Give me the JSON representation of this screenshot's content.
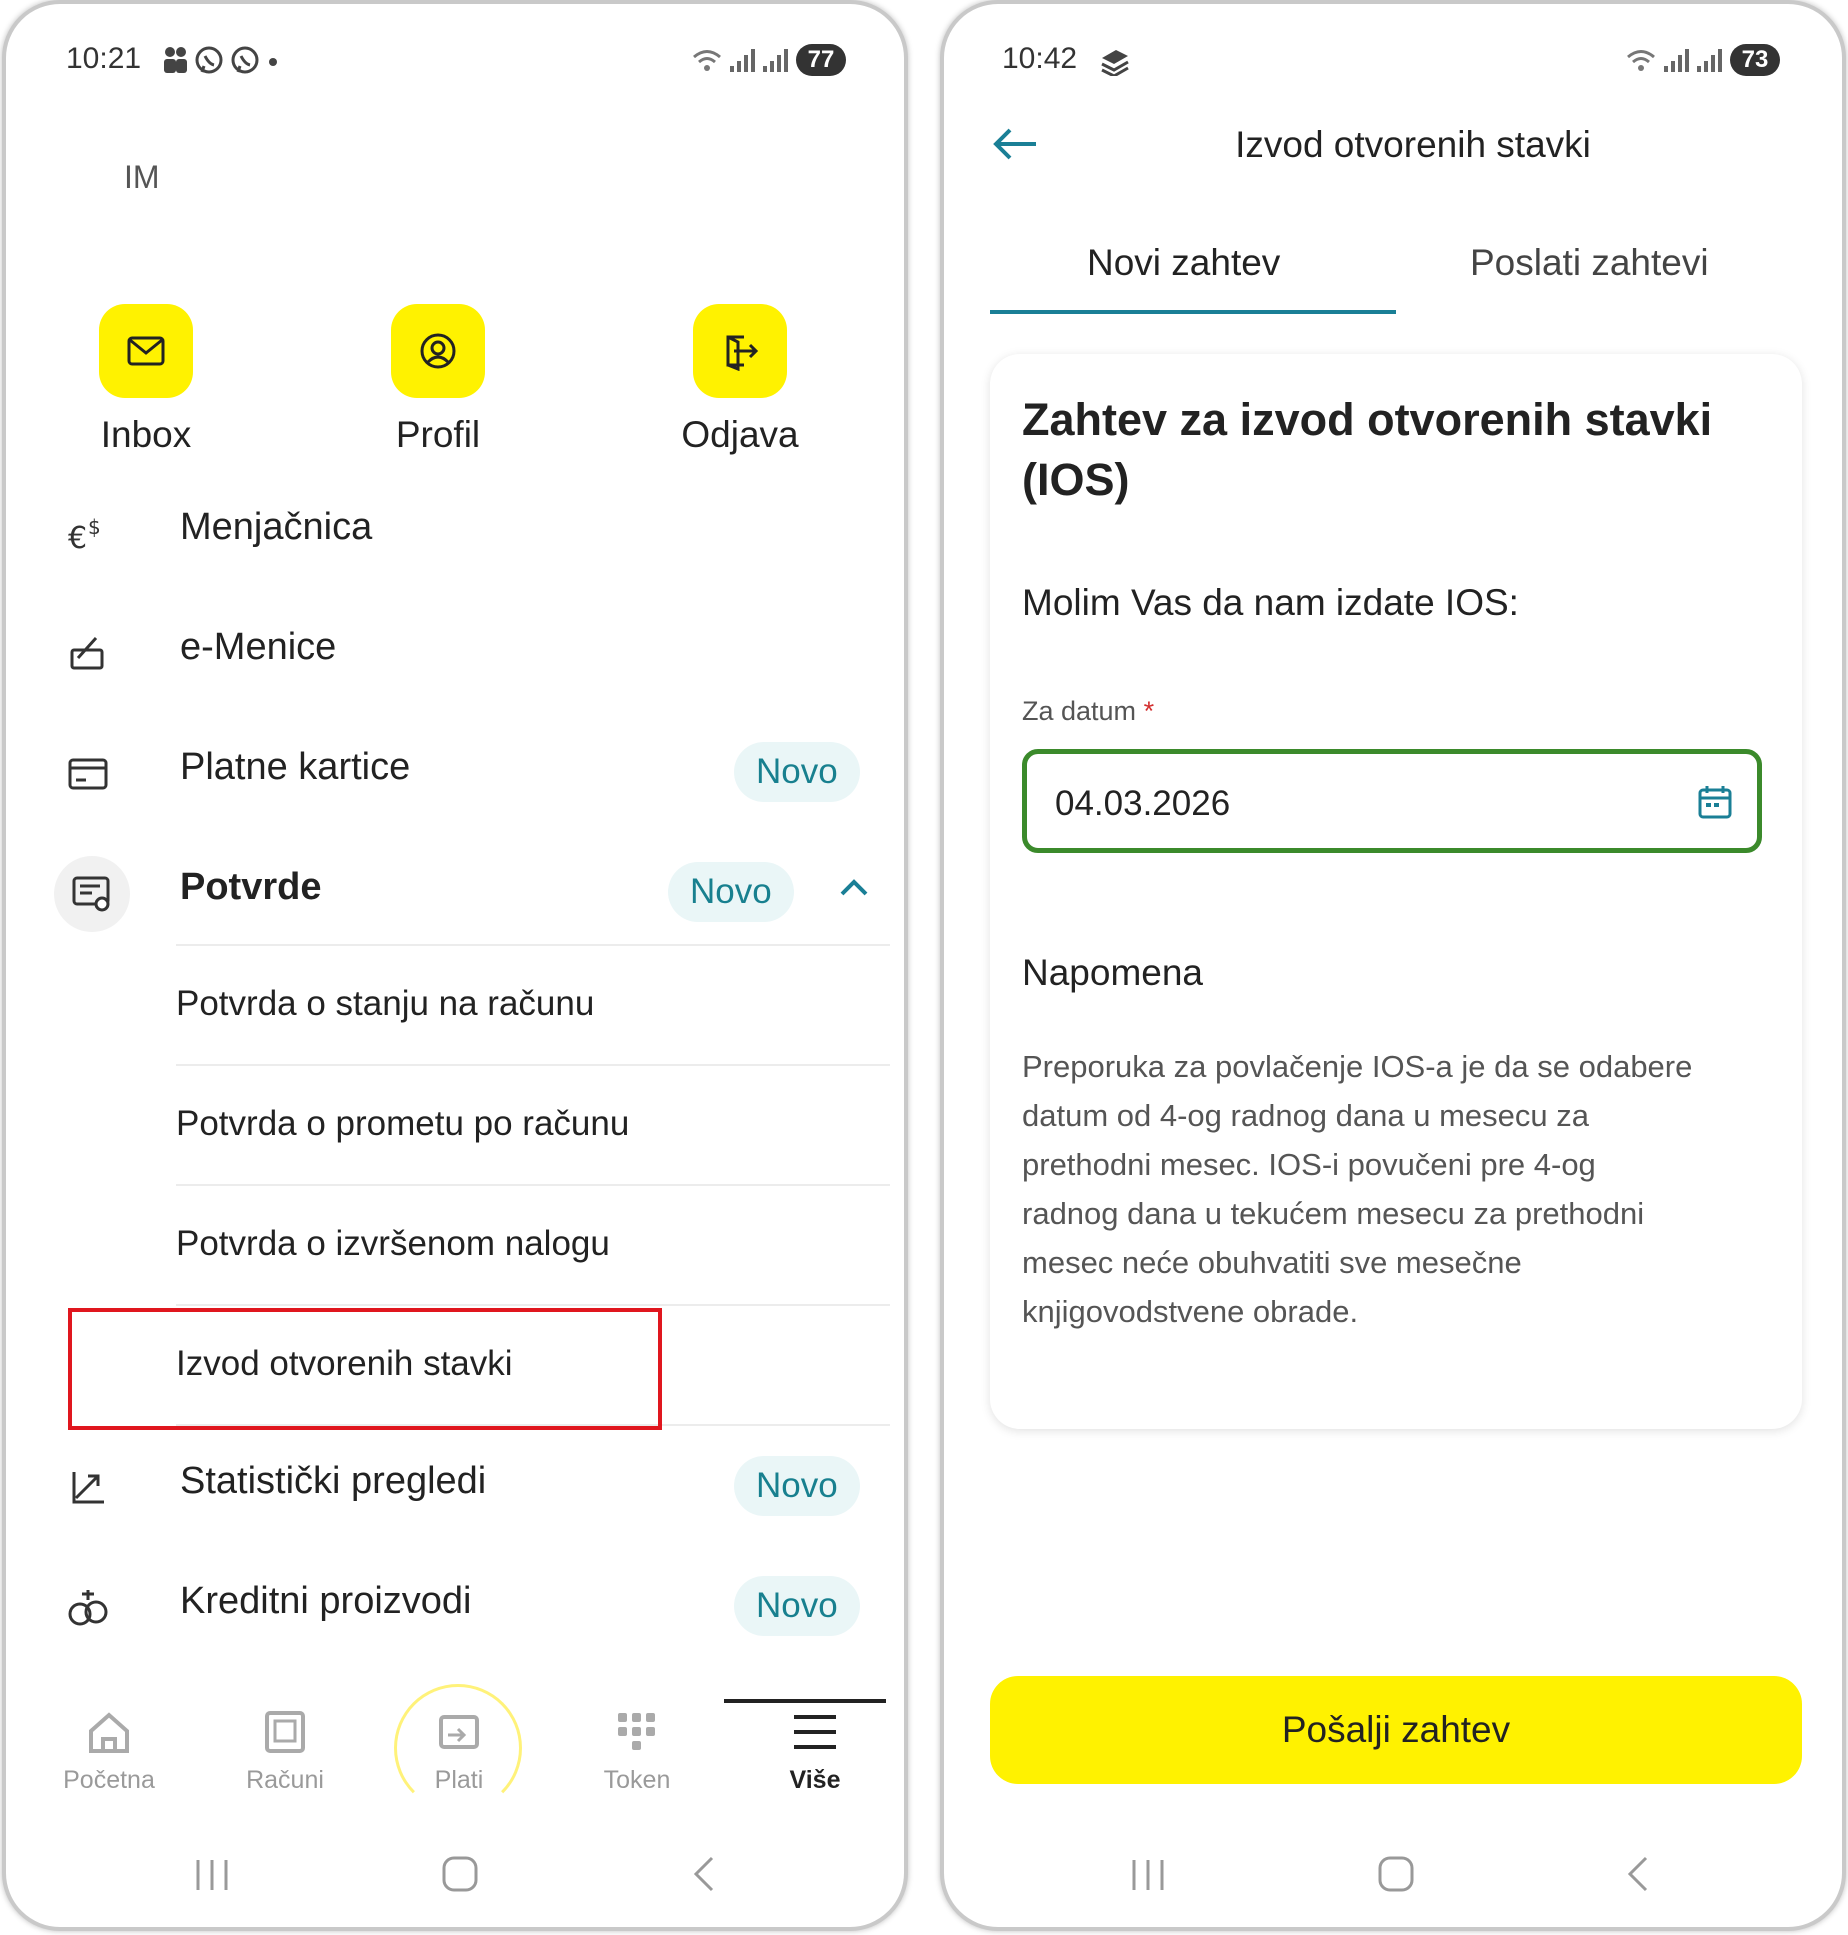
{
  "left": {
    "status": {
      "time": "10:21",
      "battery": "77"
    },
    "user_initials": "IM",
    "quick_actions": [
      {
        "label": "Inbox",
        "icon": "mail-icon"
      },
      {
        "label": "Profil",
        "icon": "profile-icon"
      },
      {
        "label": "Odjava",
        "icon": "logout-icon"
      }
    ],
    "menu": {
      "menjacnica": "Menjačnica",
      "emenice": "e-Menice",
      "platne_kartice": "Platne kartice",
      "potvrde": "Potvrde",
      "statisticki": "Statistički pregledi",
      "kreditni": "Kreditni proizvodi",
      "badge_new": "Novo"
    },
    "potvrde_items": [
      "Potvrda o stanju na računu",
      "Potvrda o prometu po računu",
      "Potvrda o izvršenom nalogu",
      "Izvod otvorenih stavki"
    ],
    "bottom_nav": [
      {
        "label": "Početna",
        "icon": "home-icon"
      },
      {
        "label": "Računi",
        "icon": "accounts-icon"
      },
      {
        "label": "Plati",
        "icon": "pay-icon"
      },
      {
        "label": "Token",
        "icon": "token-icon"
      },
      {
        "label": "Više",
        "icon": "menu-icon"
      }
    ],
    "highlight_color": "#e0161e",
    "accent_yellow": "#fff200"
  },
  "right": {
    "status": {
      "time": "10:42",
      "battery": "73"
    },
    "title": "Izvod otvorenih stavki",
    "tabs": [
      "Novi zahtev",
      "Poslati zahtevi"
    ],
    "card": {
      "heading_line1": "Zahtev za izvod otvorenih stavki",
      "heading_line2": "(IOS)",
      "subheading": "Molim Vas da nam izdate IOS:",
      "date_label": "Za datum",
      "required_mark": "*",
      "date_value": "04.03.2026",
      "note_title": "Napomena",
      "note_lines": [
        "Preporuka za povlačenje IOS-a je da se odabere",
        "datum od 4-og radnog dana u mesecu za",
        "prethodni mesec. IOS-i povučeni pre 4-og",
        "radnog dana u tekućem mesecu za prethodni",
        "mesec neće obuhvatiti sve mesečne",
        "knjigovodstvene obrade."
      ]
    },
    "send_button": "Pošalji zahtev",
    "accent_teal": "#1a7f96",
    "field_border": "#3b8a2b"
  }
}
